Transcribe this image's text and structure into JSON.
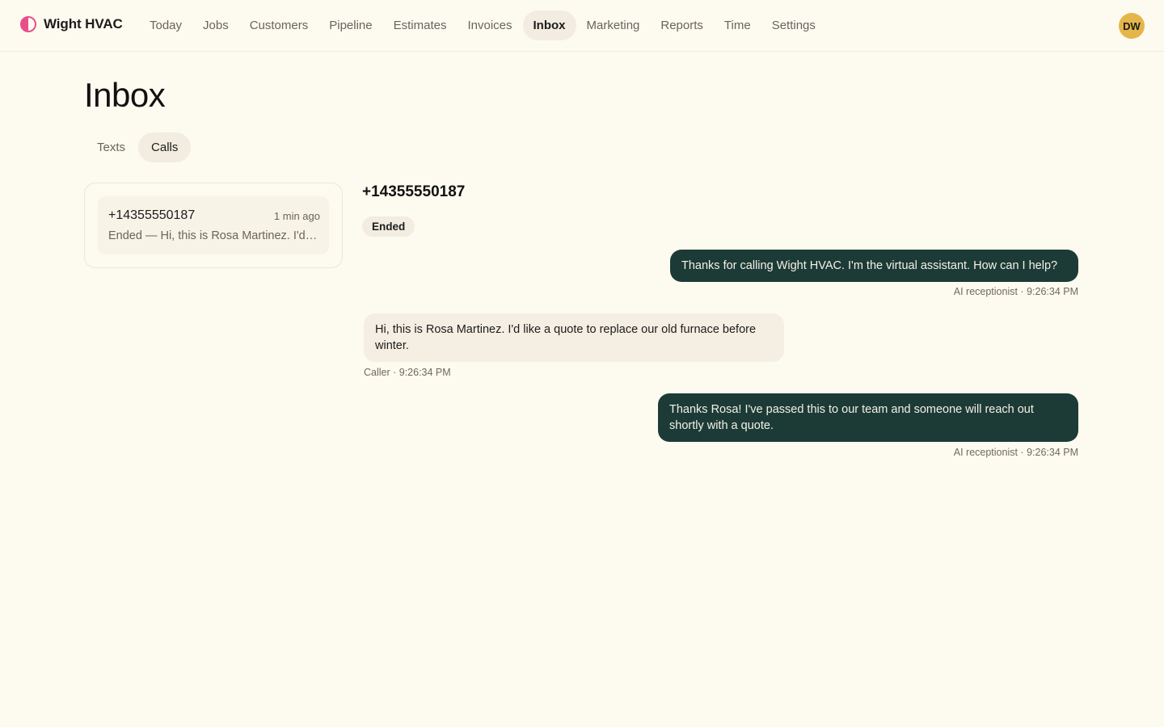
{
  "brand": {
    "name": "Wight HVAC"
  },
  "nav": {
    "items": [
      {
        "label": "Today"
      },
      {
        "label": "Jobs"
      },
      {
        "label": "Customers"
      },
      {
        "label": "Pipeline"
      },
      {
        "label": "Estimates"
      },
      {
        "label": "Invoices"
      },
      {
        "label": "Inbox"
      },
      {
        "label": "Marketing"
      },
      {
        "label": "Reports"
      },
      {
        "label": "Time"
      },
      {
        "label": "Settings"
      }
    ],
    "active": "Inbox"
  },
  "user": {
    "initials": "DW"
  },
  "page": {
    "title": "Inbox"
  },
  "tabs": {
    "texts": "Texts",
    "calls": "Calls",
    "active": "Calls"
  },
  "calls_list": [
    {
      "number": "+14355550187",
      "time_ago": "1 min ago",
      "preview": "Ended — Hi, this is Rosa Martinez. I'd like a quote to replace our old furnace before winter."
    }
  ],
  "detail": {
    "number": "+14355550187",
    "status": "Ended",
    "messages": [
      {
        "direction": "out",
        "text": "Thanks for calling Wight HVAC. I'm the virtual assistant. How can I help?",
        "meta": "AI receptionist · 9:26:34 PM"
      },
      {
        "direction": "in",
        "text": "Hi, this is Rosa Martinez. I'd like a quote to replace our old furnace before winter.",
        "meta": "Caller · 9:26:34 PM"
      },
      {
        "direction": "out",
        "text": "Thanks Rosa! I've passed this to our team and someone will reach out shortly with a quote.",
        "meta": "AI receptionist · 9:26:34 PM"
      }
    ]
  },
  "colors": {
    "background": "#fdfaf0",
    "accent": "#1d3b36",
    "brand": "#e8508a",
    "avatar": "#e4b64a"
  }
}
